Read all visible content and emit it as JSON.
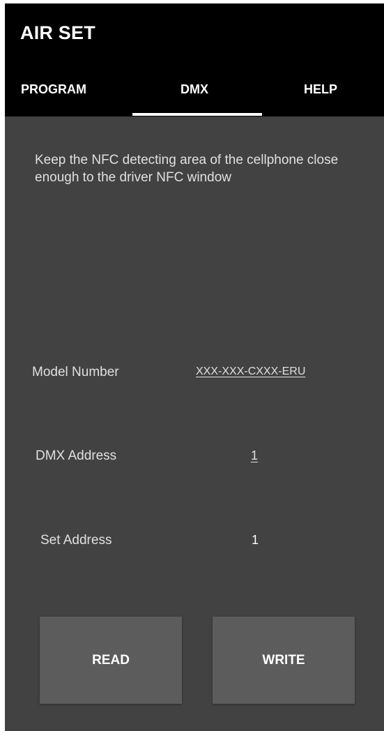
{
  "app": {
    "title": "AIR SET"
  },
  "tabs": [
    {
      "label": "PROGRAM",
      "selected": false
    },
    {
      "label": "DMX",
      "selected": true
    },
    {
      "label": "HELP",
      "selected": false
    }
  ],
  "main": {
    "instruction": "Keep the NFC detecting area of the cellphone close enough to the driver NFC window",
    "model_number": {
      "label": "Model Number",
      "value": "XXX-XXX-CXXX-ERU"
    },
    "dmx_address": {
      "label": "DMX Address",
      "value": "1"
    },
    "set_address": {
      "label": "Set Address",
      "value": "1"
    }
  },
  "buttons": {
    "read": "READ",
    "write": "WRITE"
  },
  "colors": {
    "appbar_bg": "#000000",
    "content_bg": "#424242",
    "button_bg": "#5c5c5c",
    "text": "#ffffff"
  }
}
